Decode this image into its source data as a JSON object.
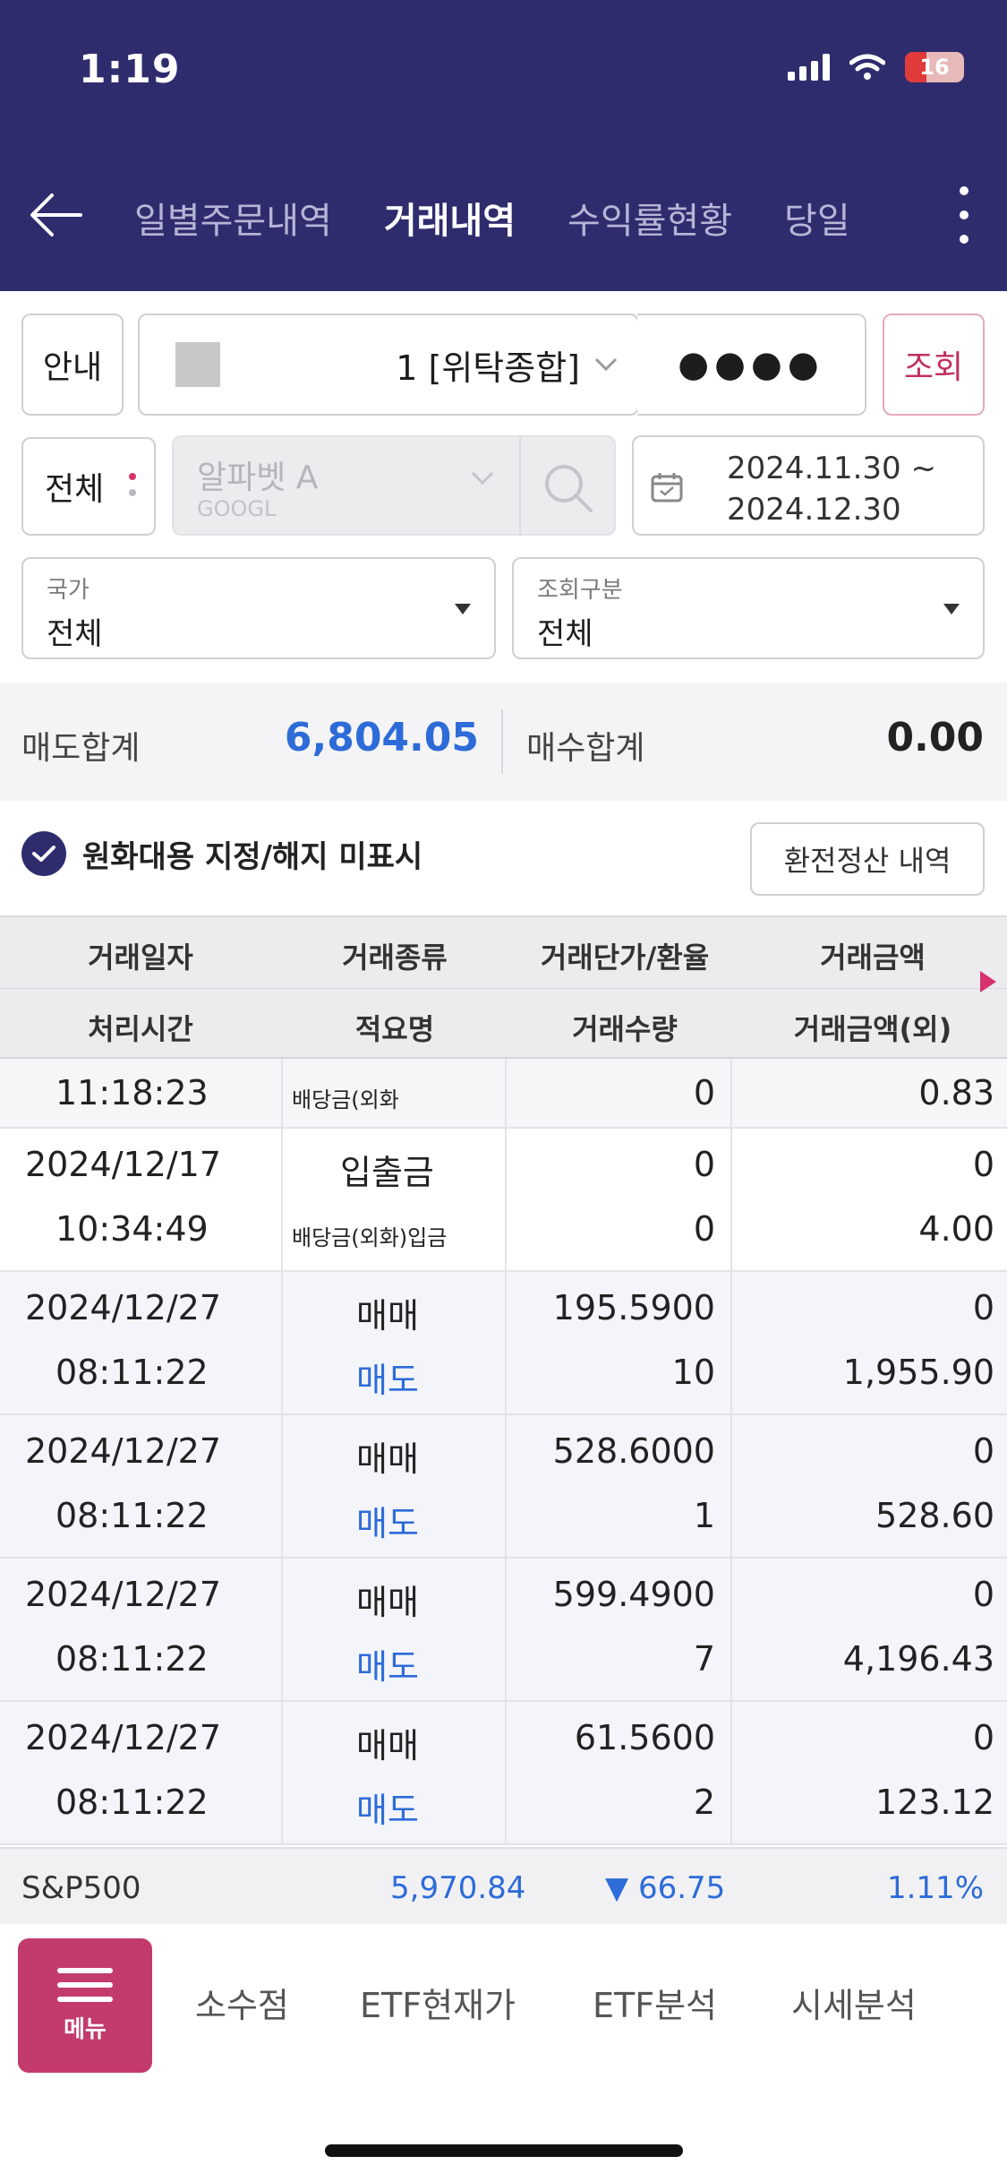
{
  "status_bar": {
    "time": "1:19",
    "battery": "16"
  },
  "nav": {
    "tabs": [
      {
        "label": "일별주문내역",
        "active": false
      },
      {
        "label": "거래내역",
        "active": true
      },
      {
        "label": "수익률현황",
        "active": false
      },
      {
        "label": "당일",
        "active": false
      }
    ]
  },
  "controls": {
    "guide_label": "안내",
    "account_text": "1 [위탁종합]",
    "password_mask": "●●●●",
    "search_label": "조회",
    "filter_all": "전체",
    "stock_name": "알파벳 A",
    "stock_code": "GOOGL",
    "date_from": "2024.11.30 ~",
    "date_to": "2024.12.30",
    "country_label": "국가",
    "country_value": "전체",
    "query_type_label": "조회구분",
    "query_type_value": "전체"
  },
  "summary": {
    "sell_label": "매도합계",
    "sell_value": "6,804.05",
    "buy_label": "매수합계",
    "buy_value": "0.00"
  },
  "options": {
    "checkbox_label": "원화대용 지정/해지 미표시",
    "checked": true,
    "fx_button": "환전정산 내역"
  },
  "table": {
    "headers_top": [
      "거래일자",
      "거래종류",
      "거래단가/환율",
      "거래금액"
    ],
    "headers_bottom": [
      "처리시간",
      "적요명",
      "거래수량",
      "거래금액(외)"
    ],
    "partial_row": {
      "time": "11:18:23",
      "memo": "배당금(외화",
      "qty": "0",
      "amount_fx": "0.83"
    },
    "rows": [
      {
        "date": "2024/12/17",
        "time": "10:34:49",
        "type": "입출금",
        "memo": "배당금(외화)입금",
        "price": "0",
        "qty": "0",
        "amount": "0",
        "amount_fx": "4.00"
      },
      {
        "date": "2024/12/27",
        "time": "08:11:22",
        "type": "매매",
        "memo": "매도",
        "price": "195.5900",
        "qty": "10",
        "amount": "0",
        "amount_fx": "1,955.90"
      },
      {
        "date": "2024/12/27",
        "time": "08:11:22",
        "type": "매매",
        "memo": "매도",
        "price": "528.6000",
        "qty": "1",
        "amount": "0",
        "amount_fx": "528.60"
      },
      {
        "date": "2024/12/27",
        "time": "08:11:22",
        "type": "매매",
        "memo": "매도",
        "price": "599.4900",
        "qty": "7",
        "amount": "0",
        "amount_fx": "4,196.43"
      },
      {
        "date": "2024/12/27",
        "time": "08:11:22",
        "type": "매매",
        "memo": "매도",
        "price": "61.5600",
        "qty": "2",
        "amount": "0",
        "amount_fx": "123.12"
      }
    ]
  },
  "ticker": {
    "name": "S&P500",
    "value": "5,970.84",
    "change": "▼ 66.75",
    "percent": "1.11%"
  },
  "bottom_bar": {
    "menu_label": "메뉴",
    "items": [
      "소수점",
      "ETF현재가",
      "ETF분석",
      "시세분석"
    ]
  },
  "colors": {
    "header_bg": "#2f2c6e",
    "accent_pink": "#c23b6c",
    "sell_blue": "#2d6bd8"
  }
}
